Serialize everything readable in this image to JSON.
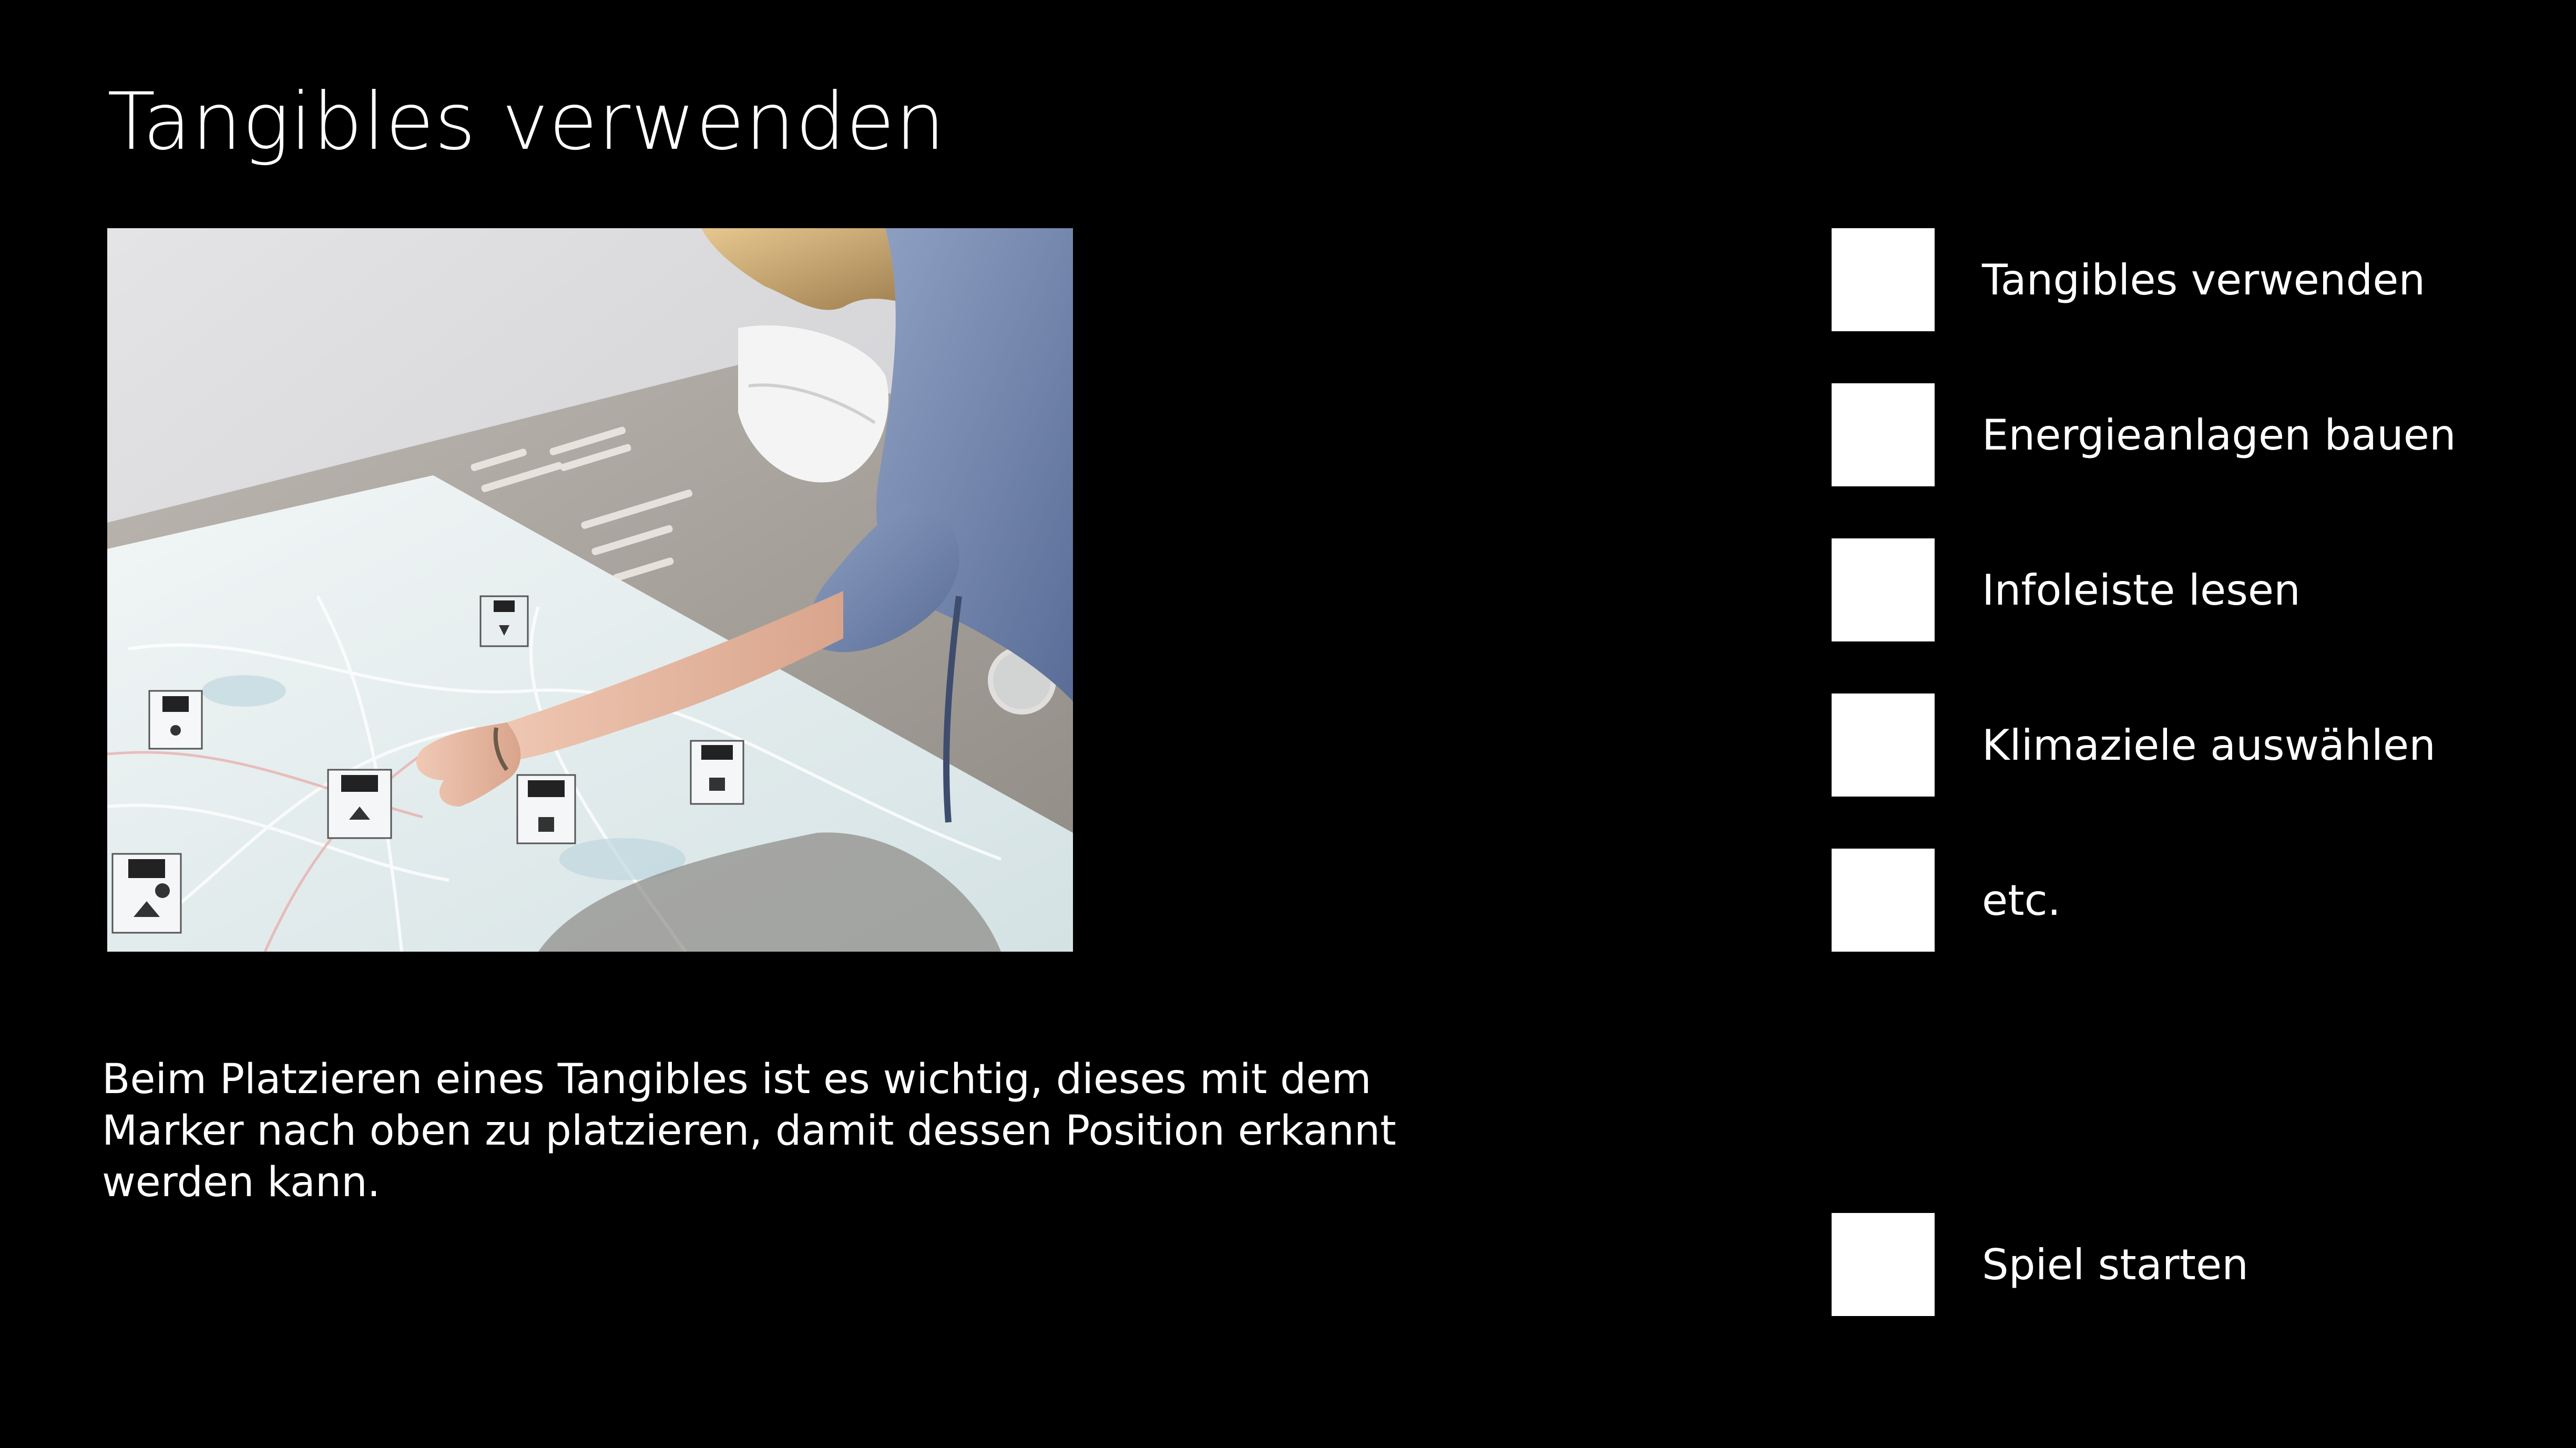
{
  "page": {
    "title": "Tangibles verwenden",
    "description": "Beim Platzieren eines Tangibles ist es wichtig, dieses mit dem Marker nach oben zu platzieren, damit dessen Position erkannt werden kann."
  },
  "checklist": {
    "items": [
      {
        "label": "Tangibles verwenden"
      },
      {
        "label": "Energieanlagen bauen"
      },
      {
        "label": "Infoleiste lesen"
      },
      {
        "label": "Klimaziele auswählen"
      },
      {
        "label": "etc."
      }
    ],
    "start": {
      "label": "Spiel starten"
    }
  },
  "colors": {
    "background": "#000000",
    "text": "#ffffff",
    "checkbox": "#ffffff"
  }
}
